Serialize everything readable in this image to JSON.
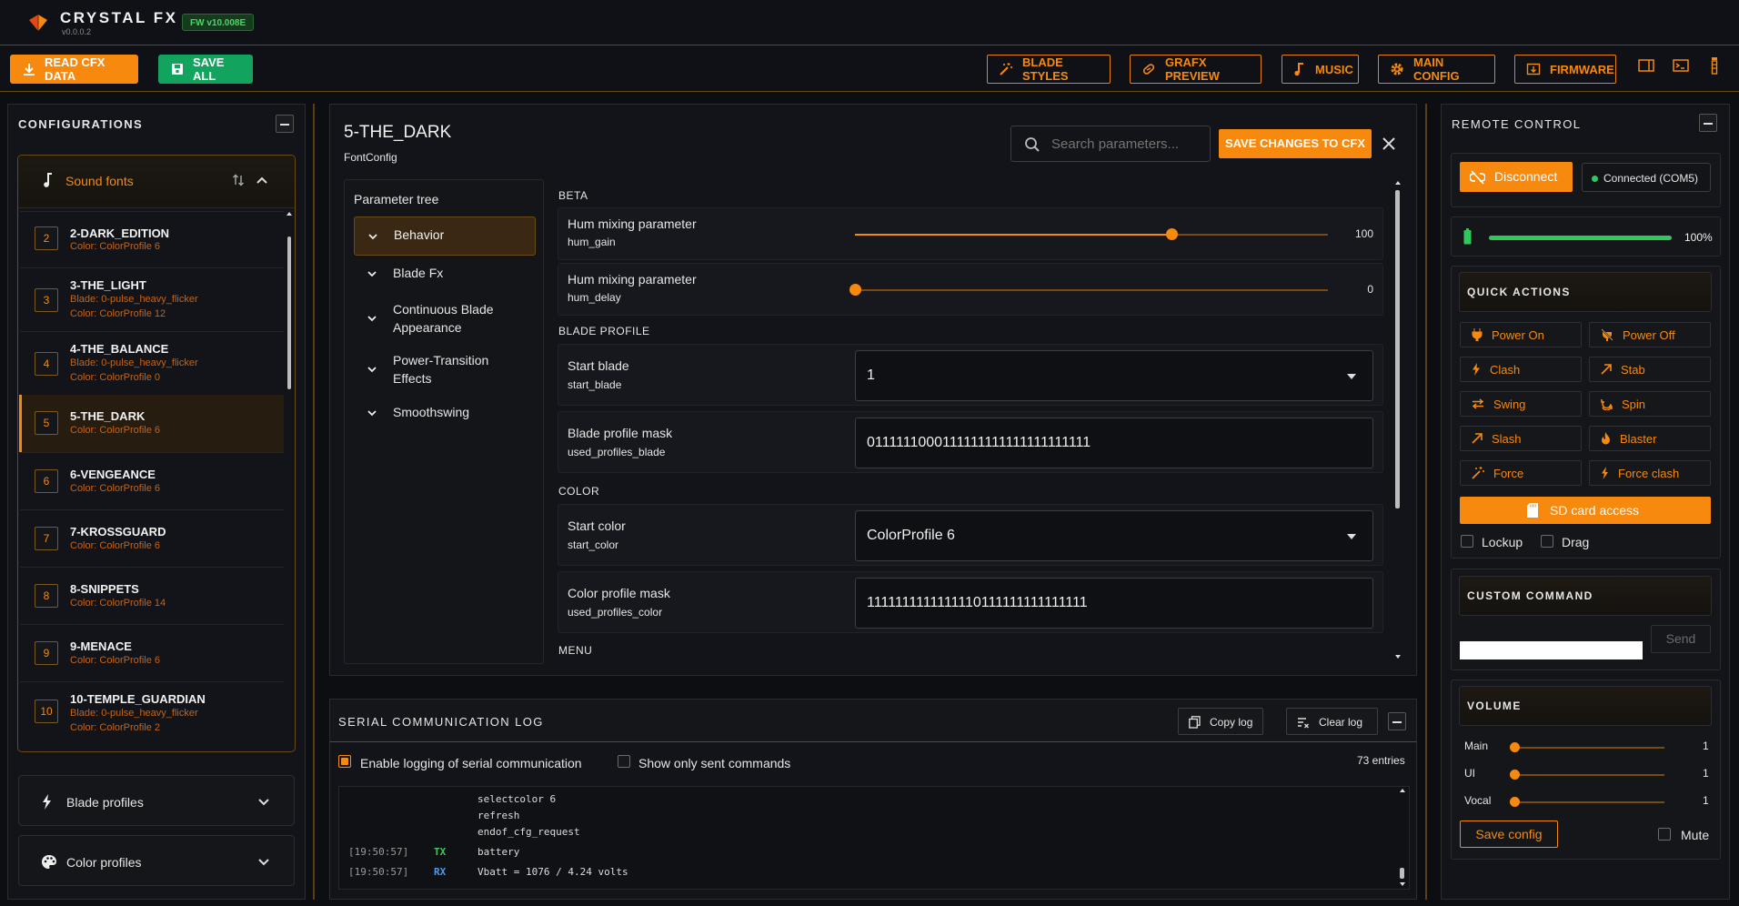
{
  "app": {
    "name": "CRYSTAL FX",
    "version": "v0.0.0.2",
    "fw_badge": "FW v10.008E",
    "accent": "#f7890e"
  },
  "toolbar": {
    "read_label": "READ CFX DATA",
    "save_all_label": "SAVE ALL",
    "blade_styles": "BLADE STYLES",
    "grafx_preview": "GRAFX PREVIEW",
    "music": "MUSIC",
    "main_config": "MAIN CONFIG",
    "firmware": "FIRMWARE"
  },
  "configurations": {
    "title": "CONFIGURATIONS",
    "sound_fonts": "Sound fonts",
    "items": [
      {
        "num": "2",
        "name": "2-DARK_EDITION",
        "lines": [
          "Color: ColorProfile 6"
        ]
      },
      {
        "num": "3",
        "name": "3-THE_LIGHT",
        "lines": [
          "Blade: 0-pulse_heavy_flicker",
          "Color: ColorProfile 12"
        ]
      },
      {
        "num": "4",
        "name": "4-THE_BALANCE",
        "lines": [
          "Blade: 0-pulse_heavy_flicker",
          "Color: ColorProfile 0"
        ]
      },
      {
        "num": "5",
        "name": "5-THE_DARK",
        "lines": [
          "Color: ColorProfile 6"
        ],
        "selected": true
      },
      {
        "num": "6",
        "name": "6-VENGEANCE",
        "lines": [
          "Color: ColorProfile 6"
        ]
      },
      {
        "num": "7",
        "name": "7-KROSSGUARD",
        "lines": [
          "Color: ColorProfile 6"
        ]
      },
      {
        "num": "8",
        "name": "8-SNIPPETS",
        "lines": [
          "Color: ColorProfile 14"
        ]
      },
      {
        "num": "9",
        "name": "9-MENACE",
        "lines": [
          "Color: ColorProfile 6"
        ]
      },
      {
        "num": "10",
        "name": "10-TEMPLE_GUARDIAN",
        "lines": [
          "Blade: 0-pulse_heavy_flicker",
          "Color: ColorProfile 2"
        ]
      }
    ],
    "blade_profiles": "Blade profiles",
    "color_profiles": "Color profiles"
  },
  "editor": {
    "title": "5-THE_DARK",
    "subtitle": "FontConfig",
    "search_placeholder": "Search parameters...",
    "save_changes": "SAVE CHANGES TO CFX",
    "tree_title": "Parameter tree",
    "tree": [
      "Behavior",
      "Blade Fx",
      "Continuous Blade Appearance",
      "Power-Transition Effects",
      "Smoothswing"
    ],
    "sections": {
      "beta": "BETA",
      "blade_profile": "BLADE PROFILE",
      "color": "COLOR",
      "menu": "MENU"
    },
    "params": {
      "hum_gain": {
        "title": "Hum mixing parameter",
        "key": "hum_gain",
        "value": "100",
        "fraction": 0.67
      },
      "hum_delay": {
        "title": "Hum mixing parameter",
        "key": "hum_delay",
        "value": "0",
        "fraction": 0.0
      },
      "start_blade": {
        "title": "Start blade",
        "key": "start_blade",
        "value": "1"
      },
      "used_profiles_blade": {
        "title": "Blade profile mask",
        "key": "used_profiles_blade",
        "value": "0111111000111111111111111111111"
      },
      "start_color": {
        "title": "Start color",
        "key": "start_color",
        "value": "ColorProfile 6"
      },
      "used_profiles_color": {
        "title": "Color profile mask",
        "key": "used_profiles_color",
        "value": "1111111111111110111111111111111"
      }
    }
  },
  "log": {
    "title": "SERIAL COMMUNICATION LOG",
    "copy": "Copy log",
    "clear": "Clear log",
    "enable_logging": "Enable logging of serial communication",
    "show_sent": "Show only sent commands",
    "entries": "73 entries",
    "lines": [
      {
        "time": "",
        "dir": "",
        "text": "selectcolor 6"
      },
      {
        "time": "",
        "dir": "",
        "text": "refresh"
      },
      {
        "time": "",
        "dir": "",
        "text": "endof_cfg_request"
      },
      {
        "time": "[19:50:57]",
        "dir": "TX",
        "text": "battery"
      },
      {
        "time": "[19:50:57]",
        "dir": "RX",
        "text": "Vbatt = 1076 / 4.24 volts"
      }
    ]
  },
  "remote": {
    "title": "REMOTE CONTROL",
    "disconnect": "Disconnect",
    "connected": "Connected (COM5)",
    "battery": "100%",
    "battery_fraction": 1.0,
    "quick_actions": "QUICK ACTIONS",
    "actions": [
      "Power On",
      "Power Off",
      "Clash",
      "Stab",
      "Swing",
      "Spin",
      "Slash",
      "Blaster",
      "Force",
      "Force clash"
    ],
    "sd_card": "SD card access",
    "lockup": "Lockup",
    "drag": "Drag",
    "custom_command": "CUSTOM COMMAND",
    "send": "Send",
    "volume": "VOLUME",
    "volumes": [
      {
        "label": "Main",
        "value": "1",
        "fraction": 0.0
      },
      {
        "label": "UI",
        "value": "1",
        "fraction": 0.0
      },
      {
        "label": "Vocal",
        "value": "1",
        "fraction": 0.0
      }
    ],
    "save_config": "Save config",
    "mute": "Mute"
  }
}
